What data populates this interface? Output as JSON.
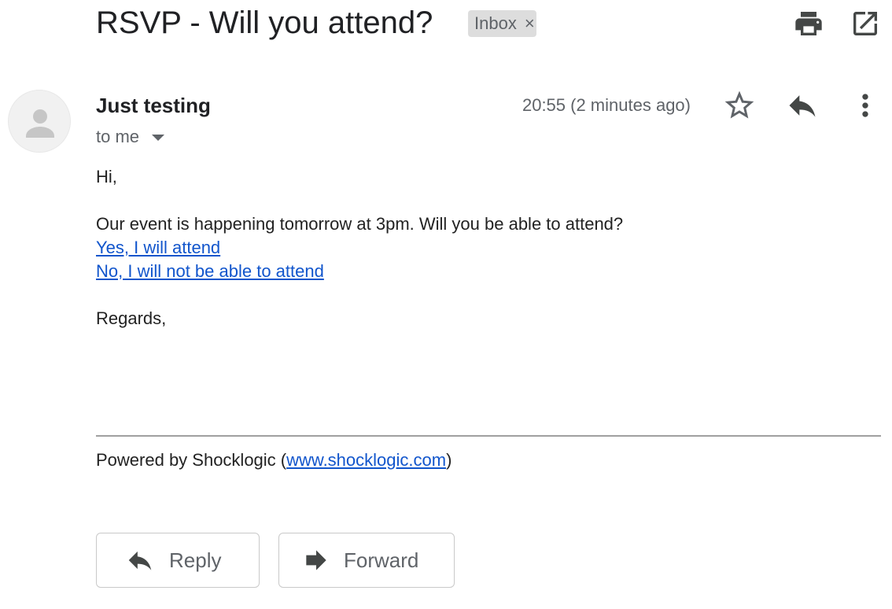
{
  "email": {
    "subject": "RSVP - Will you attend?",
    "label": "Inbox",
    "label_remove": "×",
    "sender": "Just testing",
    "recipient": "to me",
    "timestamp": "20:55 (2 minutes ago)",
    "body": {
      "greeting": "Hi,",
      "message": "Our event is happening tomorrow at 3pm. Will you be able to attend?",
      "link_yes": "Yes, I will attend",
      "link_no": "No, I will not be able to attend",
      "closing": "Regards,"
    },
    "footer": {
      "prefix": "Powered by Shocklogic (",
      "link": "www.shocklogic.com",
      "suffix": ")"
    }
  },
  "actions": {
    "reply_label": "Reply",
    "forward_label": "Forward"
  },
  "icons": {
    "print": "print-icon",
    "open_new_window": "open-in-new-window-icon",
    "star": "star-icon",
    "reply": "reply-icon",
    "more": "more-vertical-icon",
    "forward": "forward-icon",
    "avatar": "person-icon",
    "dropdown": "caret-down-icon"
  },
  "colors": {
    "link": "#1155cc",
    "secondary_text": "#5f6368",
    "label_chip_bg": "#dddddd"
  }
}
